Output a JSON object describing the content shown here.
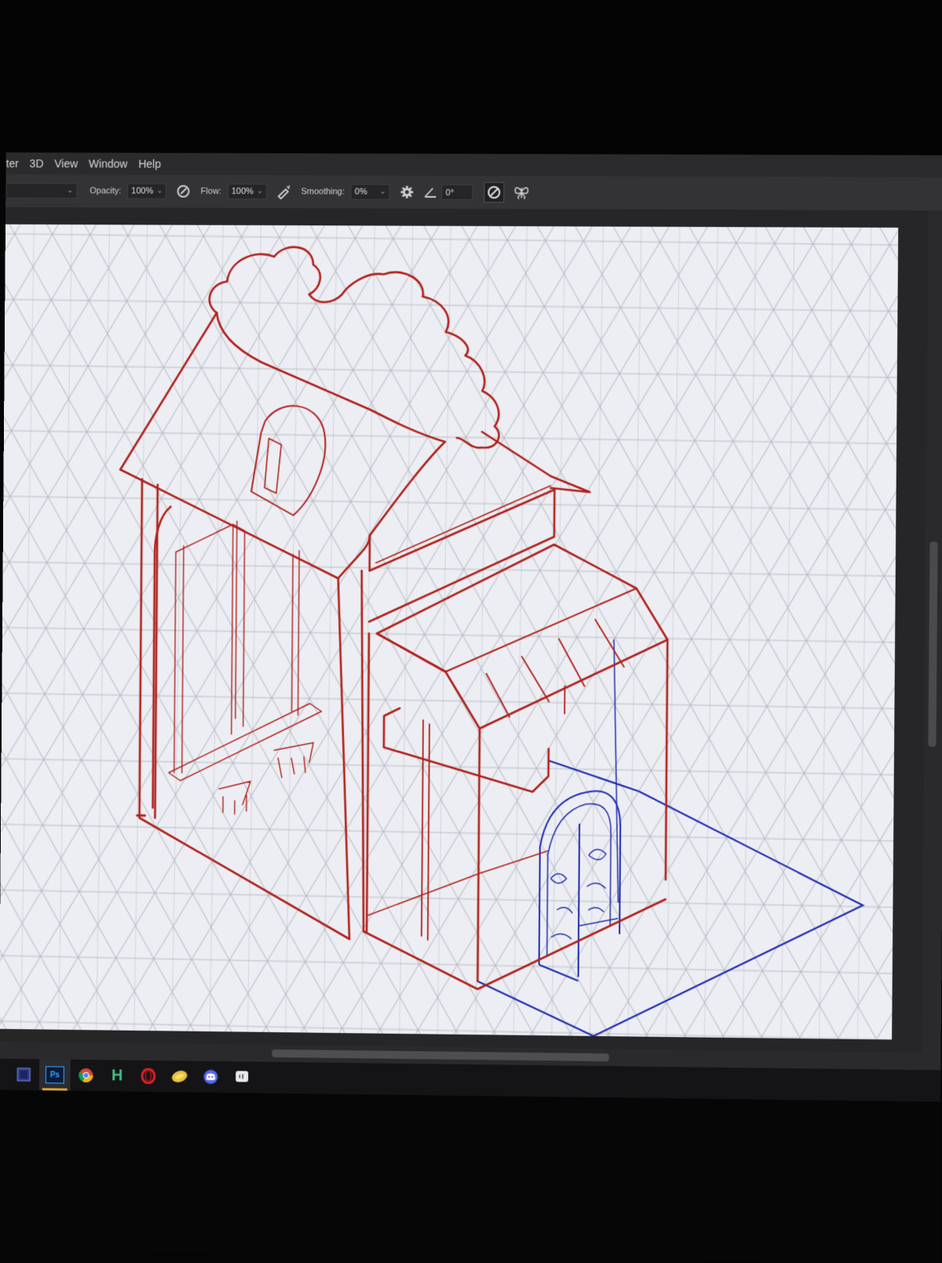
{
  "menu": {
    "items": [
      "ter",
      "3D",
      "View",
      "Window",
      "Help"
    ]
  },
  "options": {
    "opacity_label": "Opacity:",
    "opacity_value": "100%",
    "flow_label": "Flow:",
    "flow_value": "100%",
    "smoothing_label": "Smoothing:",
    "smoothing_value": "0%",
    "angle_value": "0°"
  },
  "icons": {
    "pressure_opacity": "pressure-opacity-icon",
    "airbrush": "airbrush-icon",
    "settings": "gear-icon",
    "angle": "angle-icon",
    "pressure_size": "pressure-size-icon",
    "symmetry": "butterfly-symmetry-icon"
  },
  "canvas": {
    "background": "#eceef3",
    "grid_color": "#b9bcc4",
    "sketch_red": "#b0201b",
    "sketch_blue": "#1f2bb0"
  },
  "taskbar": {
    "apps": [
      "app-icon",
      "photoshop-icon",
      "chrome-icon",
      "h-app-icon",
      "opera-icon",
      "coin-app-icon",
      "discord-icon",
      "chat-app-icon"
    ],
    "photoshop_label": "Ps",
    "h_label": "H"
  }
}
